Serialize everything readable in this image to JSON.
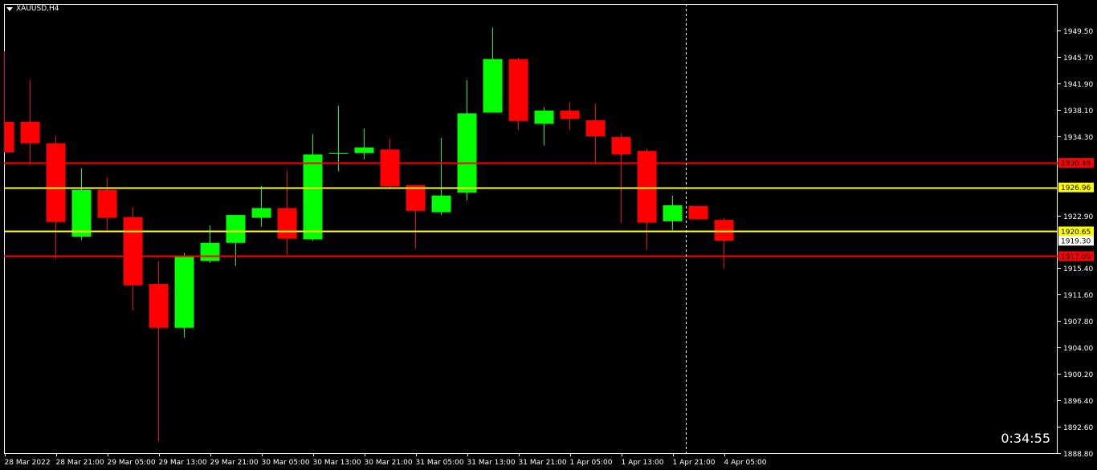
{
  "header": {
    "symbol_label": "XAUUSD,H4"
  },
  "timer": "0:34:55",
  "colors": {
    "background": "#000000",
    "frame": "#ffffff",
    "text": "#ffffff",
    "bull": "#00ff00",
    "bear": "#ff0000",
    "crosshair": "#ffffff",
    "price_tag_bg": "#ffffff",
    "price_tag_text": "#000000"
  },
  "chart_data": {
    "type": "candlestick",
    "symbol": "XAUUSD",
    "timeframe": "H4",
    "ylim": [
      1888.8,
      1953.3
    ],
    "y_ticks": [
      1949.5,
      1945.7,
      1941.9,
      1938.1,
      1934.3,
      1922.9,
      1915.4,
      1911.6,
      1907.8,
      1904.0,
      1900.2,
      1896.4,
      1892.6,
      1888.8
    ],
    "y_tick_labels": [
      "1949.50",
      "1945.70",
      "1941.90",
      "1938.10",
      "1934.30",
      "1922.90",
      "1915.40",
      "1911.60",
      "1907.80",
      "1904.00",
      "1900.20",
      "1896.40",
      "1892.60",
      "1888.80"
    ],
    "x_labels": [
      {
        "label": "28 Mar 2022",
        "index": 0
      },
      {
        "label": "28 Mar 21:00",
        "index": 2
      },
      {
        "label": "29 Mar 05:00",
        "index": 4
      },
      {
        "label": "29 Mar 13:00",
        "index": 6
      },
      {
        "label": "29 Mar 21:00",
        "index": 8
      },
      {
        "label": "30 Mar 05:00",
        "index": 10
      },
      {
        "label": "30 Mar 13:00",
        "index": 12
      },
      {
        "label": "30 Mar 21:00",
        "index": 14
      },
      {
        "label": "31 Mar 05:00",
        "index": 16
      },
      {
        "label": "31 Mar 13:00",
        "index": 18
      },
      {
        "label": "31 Mar 21:00",
        "index": 20
      },
      {
        "label": "1 Apr 05:00",
        "index": 22
      },
      {
        "label": "1 Apr 13:00",
        "index": 24
      },
      {
        "label": "1 Apr 21:00",
        "index": 26
      },
      {
        "label": "4 Apr 05:00",
        "index": 28
      }
    ],
    "candles": [
      {
        "open": 1936.4,
        "high": 1946.5,
        "low": 1932.0,
        "close": 1932.0,
        "note": "partially visible"
      },
      {
        "open": 1936.4,
        "high": 1942.4,
        "low": 1930.2,
        "close": 1933.3
      },
      {
        "open": 1933.3,
        "high": 1934.4,
        "low": 1916.7,
        "close": 1922.0
      },
      {
        "open": 1919.9,
        "high": 1929.7,
        "low": 1919.4,
        "close": 1926.6
      },
      {
        "open": 1926.6,
        "high": 1928.4,
        "low": 1920.7,
        "close": 1922.6
      },
      {
        "open": 1922.7,
        "high": 1924.1,
        "low": 1909.3,
        "close": 1912.9
      },
      {
        "open": 1913.1,
        "high": 1916.3,
        "low": 1890.5,
        "close": 1906.8
      },
      {
        "open": 1906.8,
        "high": 1917.6,
        "low": 1905.4,
        "close": 1917.1
      },
      {
        "open": 1916.4,
        "high": 1921.5,
        "low": 1916.1,
        "close": 1919.0
      },
      {
        "open": 1919.0,
        "high": 1923.0,
        "low": 1915.7,
        "close": 1923.0
      },
      {
        "open": 1922.6,
        "high": 1927.2,
        "low": 1921.3,
        "close": 1924.0
      },
      {
        "open": 1924.0,
        "high": 1929.4,
        "low": 1917.3,
        "close": 1919.6
      },
      {
        "open": 1919.5,
        "high": 1934.6,
        "low": 1919.3,
        "close": 1931.7
      },
      {
        "open": 1931.8,
        "high": 1938.7,
        "low": 1929.3,
        "close": 1931.9
      },
      {
        "open": 1931.9,
        "high": 1935.4,
        "low": 1931.0,
        "close": 1932.7
      },
      {
        "open": 1932.4,
        "high": 1934.0,
        "low": 1926.7,
        "close": 1927.1
      },
      {
        "open": 1927.3,
        "high": 1927.3,
        "low": 1918.2,
        "close": 1923.6
      },
      {
        "open": 1923.4,
        "high": 1934.1,
        "low": 1923.0,
        "close": 1925.8
      },
      {
        "open": 1926.2,
        "high": 1942.4,
        "low": 1925.1,
        "close": 1937.6
      },
      {
        "open": 1937.7,
        "high": 1949.9,
        "low": 1937.7,
        "close": 1945.4
      },
      {
        "open": 1945.4,
        "high": 1945.6,
        "low": 1935.2,
        "close": 1936.5
      },
      {
        "open": 1936.1,
        "high": 1938.5,
        "low": 1933.0,
        "close": 1938.0
      },
      {
        "open": 1938.0,
        "high": 1939.2,
        "low": 1935.2,
        "close": 1936.8
      },
      {
        "open": 1936.6,
        "high": 1939.0,
        "low": 1930.3,
        "close": 1934.3
      },
      {
        "open": 1934.2,
        "high": 1934.7,
        "low": 1921.9,
        "close": 1931.7
      },
      {
        "open": 1932.2,
        "high": 1932.5,
        "low": 1918.0,
        "close": 1921.9
      },
      {
        "open": 1922.1,
        "high": 1925.8,
        "low": 1920.8,
        "close": 1924.4
      },
      {
        "open": 1924.3,
        "high": 1924.3,
        "low": 1922.3,
        "close": 1922.4
      },
      {
        "open": 1922.3,
        "high": 1922.6,
        "low": 1915.3,
        "close": 1919.3
      }
    ],
    "horizontal_lines": [
      {
        "price": 1930.49,
        "label": "1930.49",
        "color": "#ff0000"
      },
      {
        "price": 1926.96,
        "label": "1926.96",
        "color": "#ffff00"
      },
      {
        "price": 1920.65,
        "label": "1920.65",
        "color": "#ffff00"
      },
      {
        "price": 1917.09,
        "label": "1917.09",
        "color": "#ff0000"
      }
    ],
    "current_price": {
      "price": 1919.3,
      "label": "1919.30"
    },
    "crosshair_index": 26.5
  }
}
